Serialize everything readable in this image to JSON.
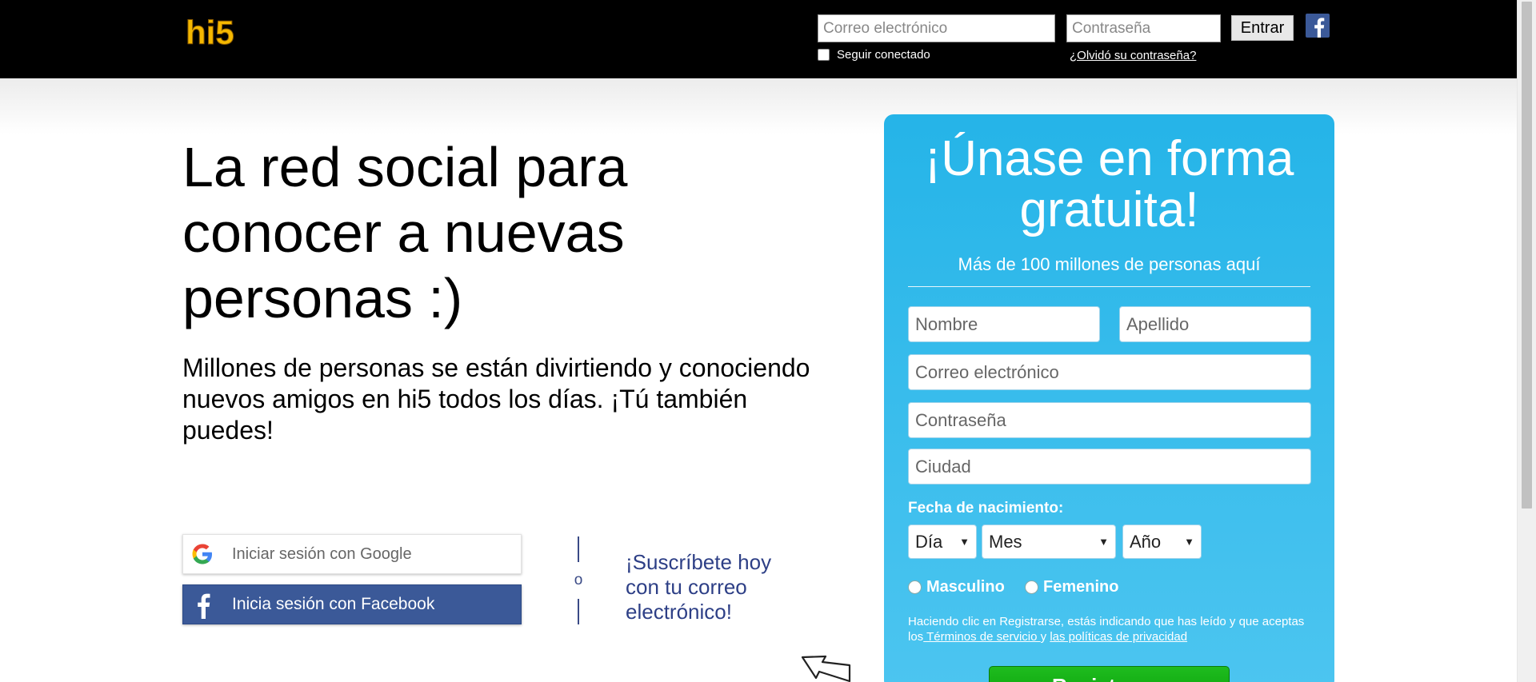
{
  "header": {
    "logo_text": "hi5",
    "email_placeholder": "Correo electrónico",
    "password_placeholder": "Contraseña",
    "enter_label": "Entrar",
    "keep_logged_label": "Seguir conectado",
    "forgot_label": "¿Olvidó su contraseña?",
    "facebook_icon": "facebook-icon"
  },
  "hero": {
    "headline": "La red social para conocer a nuevas personas :)",
    "subtext": "Millones de personas se están divirtiendo y conociendo nuevos amigos en hi5 todos los días. ¡Tú también puedes!",
    "google_label": "Iniciar sesión con Google",
    "facebook_label": "Inicia sesión con Facebook",
    "or_label": "o",
    "subscribe_text": "¡Suscríbete hoy con tu correo electrónico!"
  },
  "signup": {
    "title": "¡Únase en forma gratuita!",
    "subtitle": "Más de 100 millones de personas aquí",
    "first_name_placeholder": "Nombre",
    "last_name_placeholder": "Apellido",
    "email_placeholder": "Correo electrónico",
    "password_placeholder": "Contraseña",
    "city_placeholder": "Ciudad",
    "dob_label": "Fecha de nacimiento:",
    "day_label": "Día",
    "month_label": "Mes",
    "year_label": "Año",
    "male_label": "Masculino",
    "female_label": "Femenino",
    "terms_prefix": "Haciendo clic en Registrarse, estás indicando que has leído y que aceptas los",
    "terms_link": " Términos de servicio ",
    "terms_and": " y",
    "privacy_link": "las políticas de privacidad",
    "register_label": "Registrarse"
  },
  "colors": {
    "card_top": "#25b4e8",
    "facebook": "#3b5998",
    "register": "#1fbc1f"
  }
}
